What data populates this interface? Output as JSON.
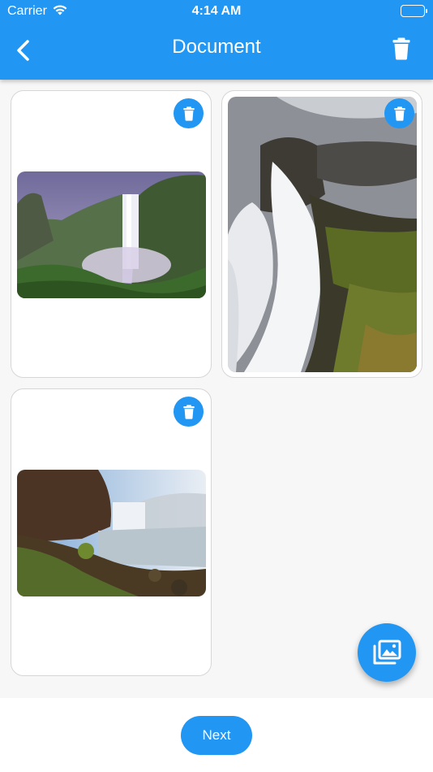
{
  "status_bar": {
    "carrier": "Carrier",
    "time": "4:14 AM"
  },
  "app_bar": {
    "title": "Document",
    "back_icon": "back-arrow-icon",
    "delete_all_icon": "trash-icon"
  },
  "documents": [
    {
      "image": "waterfall-valley-purple-sky"
    },
    {
      "image": "waterfall-rocks-long-exposure"
    },
    {
      "image": "waterfall-canyon-mist"
    }
  ],
  "fab": {
    "icon": "gallery-icon"
  },
  "footer": {
    "next_label": "Next"
  },
  "colors": {
    "primary": "#2196f3",
    "background": "#f7f7f7",
    "card": "#ffffff"
  }
}
